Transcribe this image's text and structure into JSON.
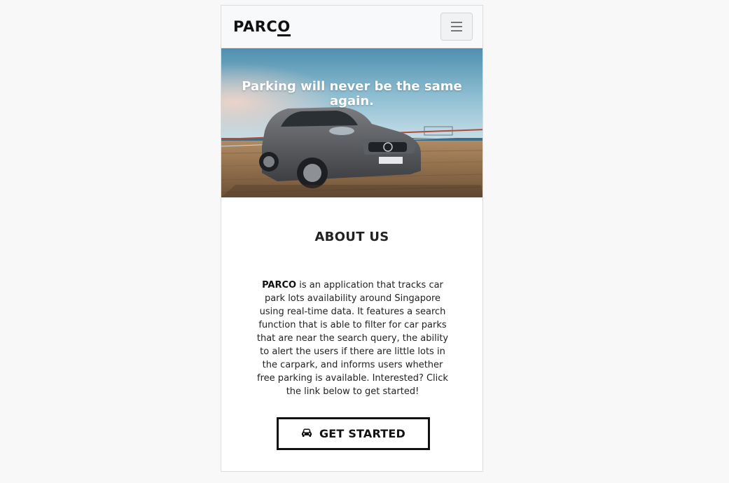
{
  "navbar": {
    "brand_main": "PARC",
    "brand_last": "O",
    "toggler_icon": "hamburger-menu-icon"
  },
  "hero": {
    "title": "Parking will never be the same again.",
    "image": "car-on-pier-photo"
  },
  "about": {
    "heading": "ABOUT US",
    "brand_bold": "PARCO",
    "body": " is an application that tracks car park lots availability around Singapore using real-time data. It features a search function that is able to filter for car parks that are near the search query, the ability to alert the users if there are little lots in the carpark, and informs users whether free parking is available. Interested? Click the link below to get started!"
  },
  "cta": {
    "label": "GET STARTED",
    "icon": "car-icon"
  }
}
